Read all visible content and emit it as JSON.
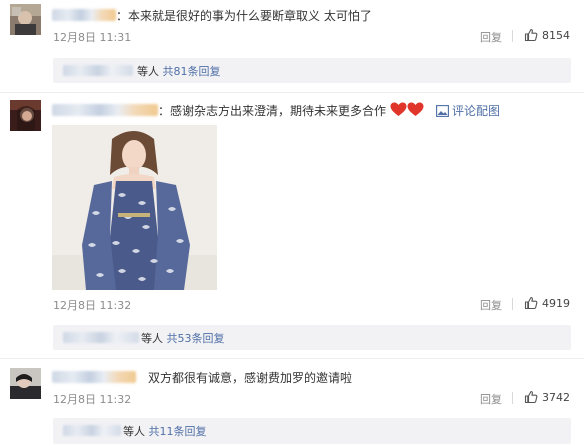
{
  "comments": [
    {
      "text": "：本来就是很好的事为什么要断章取义 太可怕了",
      "date": "12月8日 11:31",
      "reply_label": "回复",
      "likes": "8154",
      "thread": {
        "suffix": "等人",
        "link": "共81条回复"
      }
    },
    {
      "text": "：感谢杂志方出来澄清，期待未来更多合作",
      "emoji": [
        "red-heart",
        "red-heart"
      ],
      "view_image": "评论配图",
      "date": "12月8日 11:32",
      "reply_label": "回复",
      "likes": "4919",
      "thread": {
        "suffix": "等人",
        "link": "共53条回复"
      }
    },
    {
      "text": "双方都很有诚意，感谢费加罗的邀请啦",
      "date": "12月8日 11:32",
      "reply_label": "回复",
      "likes": "3742",
      "thread": {
        "suffix": "等人",
        "link": "共11条回复"
      }
    }
  ],
  "icons": {
    "like": "thumbs-up-icon",
    "image": "image-icon",
    "heart": "heart-icon"
  },
  "colors": {
    "link": "#4f6fa6",
    "meta": "#8c8c8c",
    "reply_bar_bg": "#f2f2f5",
    "heart": "#e0352b"
  }
}
